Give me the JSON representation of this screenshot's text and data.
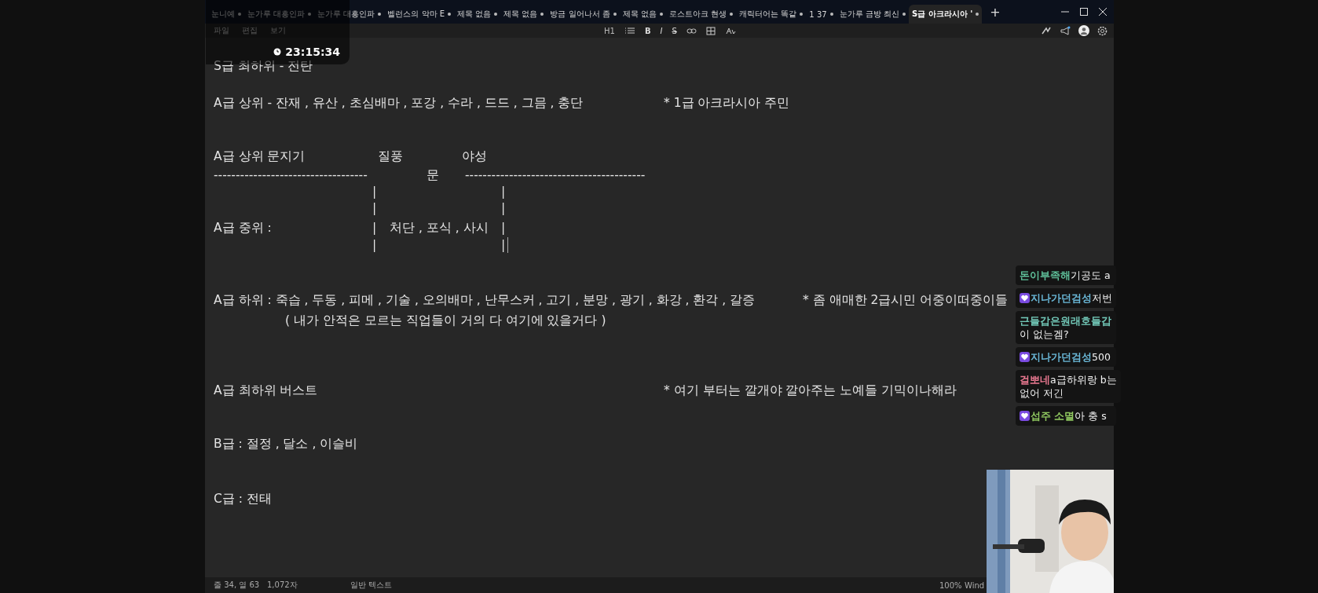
{
  "window": {
    "tabs": [
      {
        "label": "눈니예",
        "selected": false,
        "modified": true
      },
      {
        "label": "눈가루 대흥인파",
        "selected": false,
        "modified": true
      },
      {
        "label": "눈가루 대흥인파",
        "selected": false,
        "modified": true
      },
      {
        "label": "벨런스의 악마 E",
        "selected": false,
        "modified": true
      },
      {
        "label": "제목 없음",
        "selected": false,
        "modified": true
      },
      {
        "label": "제목 없음",
        "selected": false,
        "modified": true
      },
      {
        "label": "방금 일어나서 좀",
        "selected": false,
        "modified": true
      },
      {
        "label": "제목 없음",
        "selected": false,
        "modified": true
      },
      {
        "label": "로스트아크 현생",
        "selected": false,
        "modified": true
      },
      {
        "label": "캐릭터어는 똑같",
        "selected": false,
        "modified": true
      },
      {
        "label": "1 37",
        "selected": false,
        "modified": true
      },
      {
        "label": "눈가루 금방 최신",
        "selected": false,
        "modified": true
      },
      {
        "label": "S급 아크라시아 '",
        "selected": true,
        "modified": true
      }
    ],
    "new_tab": "+"
  },
  "menu": [
    "파일",
    "편집",
    "보기"
  ],
  "toolbar": {
    "heading": "H1",
    "bold": "B",
    "italic": "I",
    "strike": "S"
  },
  "editor": {
    "lines": [
      {
        "segments": [
          "S급 최하위 - 전탄"
        ]
      },
      {
        "segments": [
          "A급 상위 - 잔재 , 유산 , 초심배마 , 포강 , 수라 , 드드 , 그믐 , 충단",
          "*  1급 아크라시아 주민"
        ]
      },
      {
        "segments": [
          "A급 상위 문지기",
          "질풍",
          "야성"
        ]
      },
      {
        "segments": [
          "-----------------------------------",
          "문",
          "-----------------------------------------"
        ]
      },
      {
        "segments": [
          "|",
          "|"
        ]
      },
      {
        "segments": [
          "|",
          "|"
        ]
      },
      {
        "segments": [
          "A급 중위 :",
          "|",
          "처단 , 포식 , 사시",
          "|"
        ]
      },
      {
        "segments": [
          "|",
          "|"
        ],
        "cursor": true
      },
      {
        "segments": [
          "A급 하위 :  죽습 , 두동 , 피메 , 기술 , 오의배마 , 난무스커 , 고기 , 분망 , 광기 , 화강 , 환각 , 갈증",
          "* 좀 애매한 2급시민 어중이떠중이들"
        ]
      },
      {
        "segments": [
          "( 내가 안적은 모르는 직업들이 거의 다 여기에 있을거다 )"
        ]
      },
      {
        "segments": [
          "A급 최하위  버스트",
          "* 여기 부터는 깔개야 깔아주는 노예들 기믹이나해라"
        ]
      },
      {
        "segments": [
          "B급 : 절정 , 달소 , 이슬비"
        ]
      },
      {
        "segments": [
          "C급 : 전태"
        ]
      }
    ]
  },
  "status_bar": {
    "position": "줄 34, 열 63",
    "chars": "1,072자",
    "format": "일반 텍스트",
    "zoom": "100%",
    "encoding": "Wind"
  },
  "clock": "23:15:34",
  "chat": [
    {
      "name": "돈이부족해",
      "color": "#5fc09a",
      "badge": false,
      "text": "기공도 a"
    },
    {
      "name": "지나가던검성",
      "color": "#6ab8d8",
      "badge": true,
      "text": "저번"
    },
    {
      "name": "근들갑은원래호들갑",
      "color": "#72c8b8",
      "badge": false,
      "text_line2": "이 없는겜?"
    },
    {
      "name": "지나가던검성",
      "color": "#6ab8d8",
      "badge": true,
      "text": "500"
    },
    {
      "name": "걸뽀네",
      "color": "#e87890",
      "badge": false,
      "text": "a급하위랑 b는",
      "text_line2": "없어 저긴"
    },
    {
      "name": "섭주 소멸",
      "color": "#90c860",
      "badge": true,
      "text": "아 충 s"
    }
  ],
  "webcam": {
    "kind": "picture"
  }
}
